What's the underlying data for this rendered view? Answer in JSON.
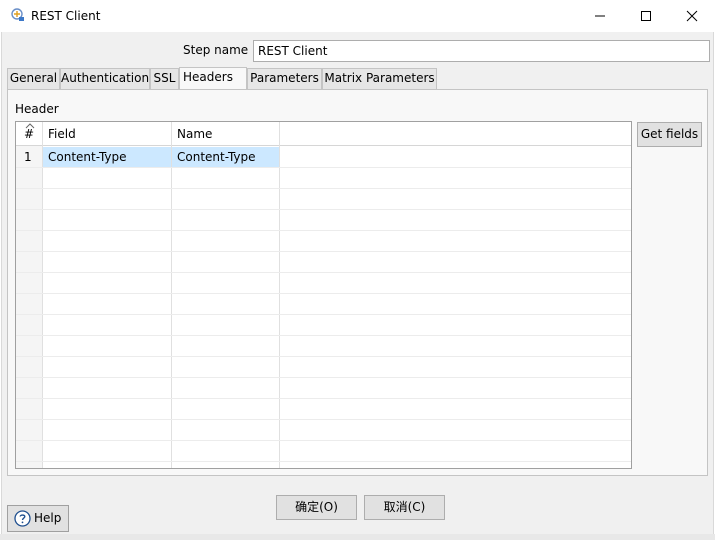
{
  "window": {
    "title": "REST Client",
    "icon": "rest-client-app-icon"
  },
  "window_controls": {
    "minimize": "minimize-icon",
    "maximize": "maximize-icon",
    "close": "close-icon"
  },
  "step": {
    "label": "Step name",
    "value": "REST Client"
  },
  "tabs": [
    {
      "label": "General"
    },
    {
      "label": "Authentication"
    },
    {
      "label": "SSL"
    },
    {
      "label": "Headers"
    },
    {
      "label": "Parameters"
    },
    {
      "label": "Matrix Parameters"
    }
  ],
  "active_tab": "Headers",
  "header_section": {
    "label": "Header",
    "columns": [
      "#",
      "Field",
      "Name"
    ],
    "rows": [
      {
        "num": "1",
        "field": "Content-Type",
        "name": "Content-Type"
      }
    ],
    "get_fields_label": "Get fields"
  },
  "buttons": {
    "ok": "确定(O)",
    "cancel": "取消(C)",
    "help": "Help"
  },
  "colors": {
    "selection": "#cce8ff",
    "panel": "#f0f0f0",
    "tab_active": "#f8f8f8"
  }
}
